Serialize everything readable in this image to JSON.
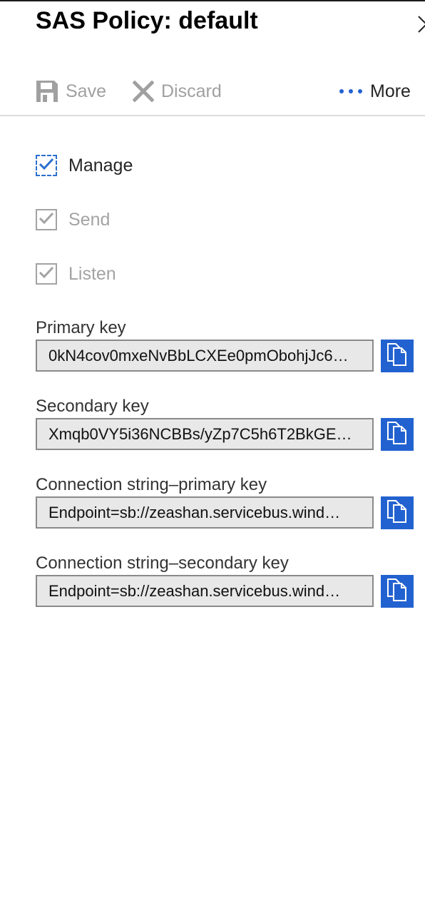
{
  "header": {
    "title": "SAS Policy: default",
    "close_icon": "close-icon"
  },
  "toolbar": {
    "save": {
      "label": "Save",
      "icon": "save-icon",
      "enabled": false
    },
    "discard": {
      "label": "Discard",
      "icon": "discard-icon",
      "enabled": false
    },
    "more": {
      "label": "More",
      "icon": "ellipsis-icon"
    }
  },
  "permissions": [
    {
      "label": "Manage",
      "checked": true,
      "enabled": true
    },
    {
      "label": "Send",
      "checked": true,
      "enabled": false
    },
    {
      "label": "Listen",
      "checked": true,
      "enabled": false
    }
  ],
  "fields": [
    {
      "label": "Primary key",
      "value": "0kN4cov0mxeNvBbLCXEe0pmObohjJc6…",
      "copy_icon": "copy-icon"
    },
    {
      "label": "Secondary key",
      "value": "Xmqb0VY5i36NCBBs/yZp7C5h6T2BkGE…",
      "copy_icon": "copy-icon"
    },
    {
      "label": "Connection string–primary key",
      "value": "Endpoint=sb://zeashan.servicebus.wind…",
      "copy_icon": "copy-icon"
    },
    {
      "label": "Connection string–secondary key",
      "value": "Endpoint=sb://zeashan.servicebus.wind…",
      "copy_icon": "copy-icon"
    }
  ],
  "colors": {
    "accent": "#2262d0",
    "checkmark_active": "#2b6fcf",
    "checkmark_disabled": "#a3a3a3",
    "field_bg": "#e8e8e8"
  }
}
